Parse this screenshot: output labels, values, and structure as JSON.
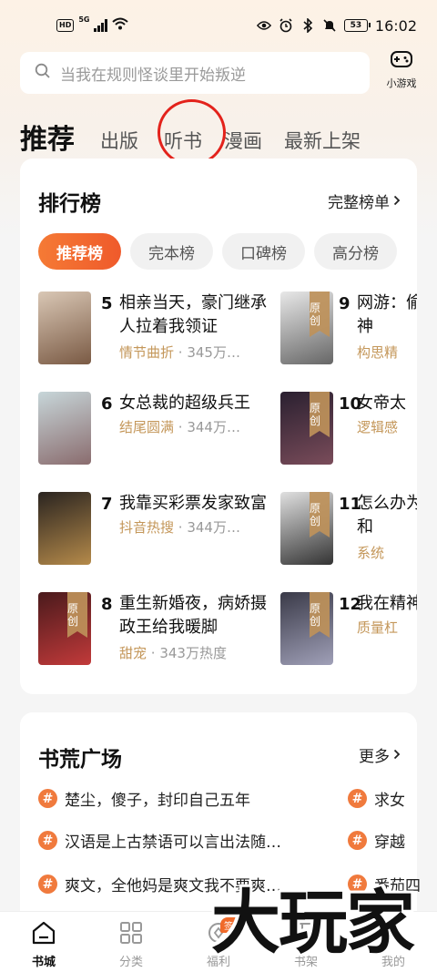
{
  "status_bar": {
    "hd": "HD",
    "network": "5G",
    "battery": "53",
    "time": "16:02"
  },
  "search": {
    "placeholder": "当我在规则怪谈里开始叛逆"
  },
  "game_button": {
    "label": "小游戏",
    "icon": "gamepad-icon"
  },
  "tabs": [
    {
      "label": "推荐",
      "active": true
    },
    {
      "label": "出版"
    },
    {
      "label": "听书"
    },
    {
      "label": "漫画"
    },
    {
      "label": "最新上架"
    }
  ],
  "ranking": {
    "title": "排行榜",
    "more": "完整榜单",
    "filters": [
      "推荐榜",
      "完本榜",
      "口碑榜",
      "高分榜"
    ],
    "badge": "原创",
    "left": [
      {
        "rank": "5",
        "title": "相亲当天，豪门继承人拉着我领证",
        "tag": "情节曲折",
        "heat": "345万…",
        "cover_colors": [
          "#d9c7b5",
          "#7a5a44"
        ]
      },
      {
        "rank": "6",
        "title": "女总裁的超级兵王",
        "tag": "结尾圆满",
        "heat": "344万…",
        "cover_colors": [
          "#c7d6d9",
          "#8a6c6e"
        ]
      },
      {
        "rank": "7",
        "title": "我靠买彩票发家致富",
        "tag": "抖音热搜",
        "heat": "344万…",
        "cover_colors": [
          "#2a2420",
          "#b58a4a"
        ]
      },
      {
        "rank": "8",
        "title": "重生新婚夜，病娇摄政王给我暖脚",
        "tag": "甜宠",
        "heat": "343万热度",
        "cover_colors": [
          "#4a1a1c",
          "#c23a3a"
        ]
      }
    ],
    "right": [
      {
        "rank": "9",
        "title": "网游：偷窃神",
        "tag": "构思精",
        "cover_colors": [
          "#e8e8e8",
          "#666666"
        ]
      },
      {
        "rank": "10",
        "title": "女帝太",
        "tag": "逻辑感",
        "cover_colors": [
          "#2a2030",
          "#7a4c5a"
        ]
      },
      {
        "rank": "11",
        "title": "怎么办为我和",
        "tag": "系统",
        "cover_colors": [
          "#e0e0e0",
          "#333333"
        ]
      },
      {
        "rank": "12",
        "title": "我在精神",
        "tag": "质量杠",
        "cover_colors": [
          "#3a3a48",
          "#a0a0b8"
        ]
      }
    ]
  },
  "plaza": {
    "title": "书荒广场",
    "more": "更多",
    "topics_left": [
      "楚尘，傻子，封印自己五年",
      "汉语是上古禁语可以言出法随…",
      "爽文，全他妈是爽文我不要爽…"
    ],
    "topics_right": [
      "求女",
      "穿越",
      "番茄四"
    ]
  },
  "bottom_nav": [
    {
      "label": "书城",
      "icon": "home-icon",
      "active": true
    },
    {
      "label": "分类",
      "icon": "grid-icon"
    },
    {
      "label": "福利",
      "icon": "coin-icon",
      "badge": "签到"
    },
    {
      "label": "书架",
      "icon": "bookshelf-icon"
    },
    {
      "label": "我的",
      "icon": "user-icon"
    }
  ],
  "watermark": "大玩家",
  "annotation_color": "#e3221b",
  "accent_color": "#f0662c"
}
